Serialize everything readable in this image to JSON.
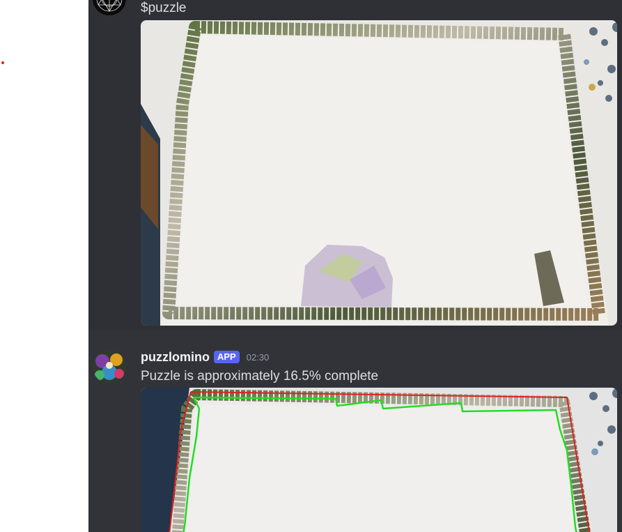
{
  "messages": [
    {
      "text": "$puzzle",
      "avatar": "geometric-logo-avatar",
      "attachment": "puzzle-photo-image"
    },
    {
      "username": "puzzlomino",
      "badge": "APP",
      "timestamp": "02:30",
      "text": "Puzzle is approximately 16.5% complete",
      "avatar": "colorful-puzzle-avatar",
      "attachment": "annotated-puzzle-photo-image"
    }
  ],
  "colors": {
    "chat_bg": "#313338",
    "badge_bg": "#5865f2",
    "username": "#f2f3f5",
    "text": "#dbdee1",
    "timestamp": "#949ba4",
    "detected_region_outline": "#22dd22",
    "board_outline": "#e02020"
  }
}
